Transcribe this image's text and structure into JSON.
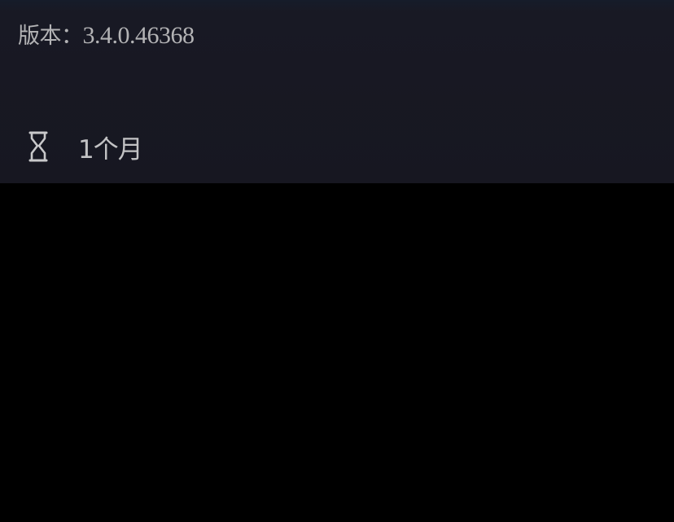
{
  "version": {
    "label": "版本：",
    "value": "3.4.0.46368"
  },
  "duration": {
    "icon": "hourglass-icon",
    "text": "1个月"
  },
  "colors": {
    "panel_background": "#171721",
    "text": "#b3b3b5",
    "lower_background": "#000000"
  }
}
